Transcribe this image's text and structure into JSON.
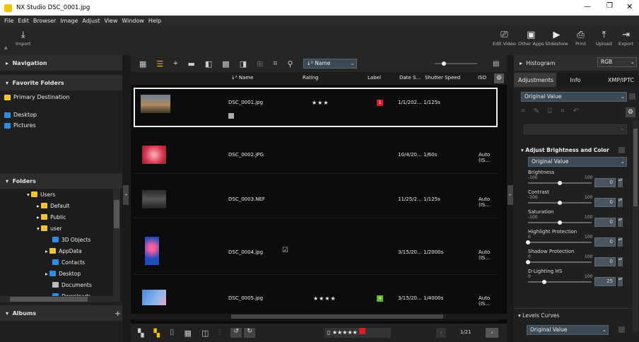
{
  "window": {
    "title": "NX Studio   DSC_0001.jpg"
  },
  "menu": [
    "File",
    "Edit",
    "Browser",
    "Image",
    "Adjust",
    "View",
    "Window",
    "Help"
  ],
  "toolbar": {
    "import": "Import",
    "edit_video": "Edit Video",
    "other_apps": "Other Apps",
    "slideshow": "Slideshow",
    "print": "Print",
    "upload": "Upload",
    "export": "Export"
  },
  "left": {
    "navigation": "Navigation",
    "favorite_folders": "Favorite Folders",
    "primary_destination": "Primary Destination",
    "desktop": "Desktop",
    "pictures": "Pictures",
    "folders": "Folders",
    "tree": [
      "Users",
      "Default",
      "Public",
      "user",
      "3D Objects",
      "AppData",
      "Contacts",
      "Desktop",
      "Documents",
      "Downloads"
    ],
    "albums": "Albums"
  },
  "center": {
    "sort": "Name",
    "columns": {
      "name": "Name",
      "rating": "Rating",
      "label": "Label",
      "date": "Date S...",
      "shutter": "Shutter Speed",
      "iso": "ISO"
    },
    "rows": [
      {
        "name": "DSC_0001.jpg",
        "rating": "★★★",
        "label": "1",
        "label_color": "#d71f2a",
        "date": "1/1/202...",
        "shutter": "1/125s",
        "iso": ""
      },
      {
        "name": "DSC_0002.JPG",
        "rating": "",
        "label": "",
        "date": "10/4/20...",
        "shutter": "1/60s",
        "iso": "Auto (IS..."
      },
      {
        "name": "DSC_0003.NEF",
        "rating": "",
        "label": "",
        "date": "11/25/2...",
        "shutter": "1/125s",
        "iso": "Auto (IS..."
      },
      {
        "name": "DSC_0004.jpg",
        "rating": "",
        "label": "",
        "date": "3/15/20...",
        "shutter": "1/2000s",
        "iso": "Auto (IS..."
      },
      {
        "name": "DSC_0005.jpg",
        "rating": "★★★★",
        "label": "4",
        "label_color": "#63b52e",
        "date": "3/15/20...",
        "shutter": "1/4000s",
        "iso": "Auto (IS..."
      }
    ],
    "page": "1/21",
    "bottom_rating": "★★★★★"
  },
  "right": {
    "histogram": "Histogram",
    "histogram_mode": "RGB",
    "tabs": [
      "Adjustments",
      "Info",
      "XMP/IPTC"
    ],
    "original_value": "Original Value",
    "adjust_section": "Adjust Brightness and Color",
    "sliders": [
      {
        "label": "Brightness",
        "min": "-100",
        "max": "100",
        "value": "0",
        "pos": 0.5
      },
      {
        "label": "Contrast",
        "min": "-100",
        "max": "100",
        "value": "0",
        "pos": 0.5
      },
      {
        "label": "Saturation",
        "min": "-100",
        "max": "100",
        "value": "0",
        "pos": 0.5
      },
      {
        "label": "Highlight Protection",
        "min": "0",
        "max": "100",
        "value": "0",
        "pos": 0.0
      },
      {
        "label": "Shadow Protection",
        "min": "0",
        "max": "100",
        "value": "0",
        "pos": 0.0
      },
      {
        "label": "D-Lighting HS",
        "min": "0",
        "max": "100",
        "value": "25",
        "pos": 0.25
      }
    ],
    "levels_curves": "Levels Curves"
  }
}
